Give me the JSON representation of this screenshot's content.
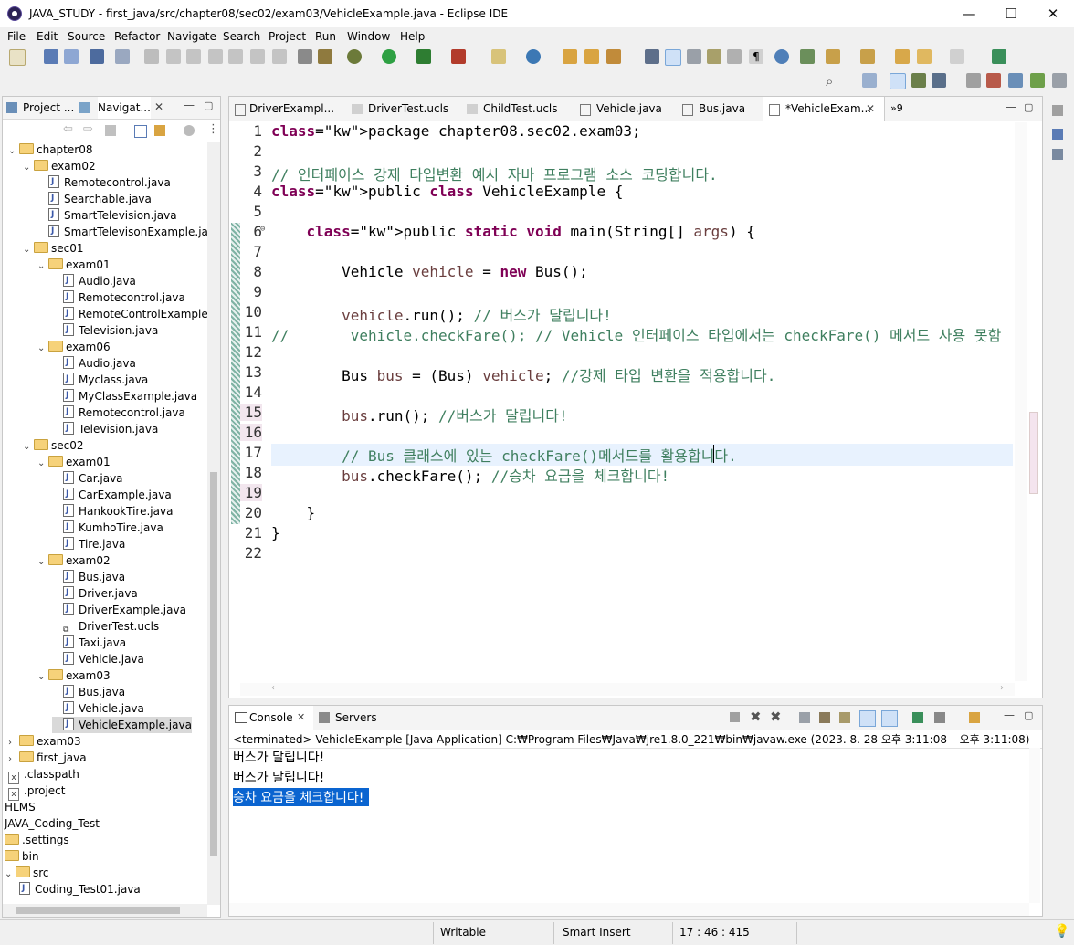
{
  "window": {
    "title": "JAVA_STUDY - first_java/src/chapter08/sec02/exam03/VehicleExample.java - Eclipse IDE",
    "minimize": "—",
    "maximize": "☐",
    "close": "✕"
  },
  "menu": [
    "File",
    "Edit",
    "Source",
    "Refactor",
    "Navigate",
    "Search",
    "Project",
    "Run",
    "Window",
    "Help"
  ],
  "left_tabs": [
    "Project ...",
    "Navigat..."
  ],
  "tree": [
    {
      "label": "chapter08",
      "indent": 0,
      "kind": "folder",
      "twist": "v"
    },
    {
      "label": "exam02",
      "indent": 1,
      "kind": "folder",
      "twist": "v"
    },
    {
      "label": "Remotecontrol.java",
      "indent": 2,
      "kind": "java"
    },
    {
      "label": "Searchable.java",
      "indent": 2,
      "kind": "java"
    },
    {
      "label": "SmartTelevision.java",
      "indent": 2,
      "kind": "java"
    },
    {
      "label": "SmartTelevisonExample.java",
      "indent": 2,
      "kind": "java"
    },
    {
      "label": "sec01",
      "indent": 1,
      "kind": "folder",
      "twist": "v"
    },
    {
      "label": "exam01",
      "indent": 2,
      "kind": "folder",
      "twist": "v"
    },
    {
      "label": "Audio.java",
      "indent": 3,
      "kind": "java"
    },
    {
      "label": "Remotecontrol.java",
      "indent": 3,
      "kind": "java"
    },
    {
      "label": "RemoteControlExample.ja",
      "indent": 3,
      "kind": "java"
    },
    {
      "label": "Television.java",
      "indent": 3,
      "kind": "java"
    },
    {
      "label": "exam06",
      "indent": 2,
      "kind": "folder",
      "twist": "v"
    },
    {
      "label": "Audio.java",
      "indent": 3,
      "kind": "java"
    },
    {
      "label": "Myclass.java",
      "indent": 3,
      "kind": "java"
    },
    {
      "label": "MyClassExample.java",
      "indent": 3,
      "kind": "java"
    },
    {
      "label": "Remotecontrol.java",
      "indent": 3,
      "kind": "java"
    },
    {
      "label": "Television.java",
      "indent": 3,
      "kind": "java"
    },
    {
      "label": "sec02",
      "indent": 1,
      "kind": "folder",
      "twist": "v"
    },
    {
      "label": "exam01",
      "indent": 2,
      "kind": "folder",
      "twist": "v"
    },
    {
      "label": "Car.java",
      "indent": 3,
      "kind": "java"
    },
    {
      "label": "CarExample.java",
      "indent": 3,
      "kind": "java"
    },
    {
      "label": "HankookTire.java",
      "indent": 3,
      "kind": "java"
    },
    {
      "label": "KumhoTire.java",
      "indent": 3,
      "kind": "java"
    },
    {
      "label": "Tire.java",
      "indent": 3,
      "kind": "java"
    },
    {
      "label": "exam02",
      "indent": 2,
      "kind": "folder",
      "twist": "v"
    },
    {
      "label": "Bus.java",
      "indent": 3,
      "kind": "java"
    },
    {
      "label": "Driver.java",
      "indent": 3,
      "kind": "java"
    },
    {
      "label": "DriverExample.java",
      "indent": 3,
      "kind": "java"
    },
    {
      "label": "DriverTest.ucls",
      "indent": 3,
      "kind": "ucls"
    },
    {
      "label": "Taxi.java",
      "indent": 3,
      "kind": "java"
    },
    {
      "label": "Vehicle.java",
      "indent": 3,
      "kind": "java"
    },
    {
      "label": "exam03",
      "indent": 2,
      "kind": "folder",
      "twist": "v"
    },
    {
      "label": "Bus.java",
      "indent": 3,
      "kind": "java"
    },
    {
      "label": "Vehicle.java",
      "indent": 3,
      "kind": "java"
    },
    {
      "label": "VehicleExample.java",
      "indent": 3,
      "kind": "java",
      "selected": true
    },
    {
      "label": "exam03",
      "indent": 0,
      "kind": "folder",
      "twist": ">"
    },
    {
      "label": "first_java",
      "indent": 0,
      "kind": "folder",
      "twist": ">"
    },
    {
      "label": ".classpath",
      "indent": -1,
      "kind": "x"
    },
    {
      "label": ".project",
      "indent": -1,
      "kind": "x"
    },
    {
      "label": "HLMS",
      "indent": -2,
      "kind": "none"
    },
    {
      "label": "JAVA_Coding_Test",
      "indent": -2,
      "kind": "none"
    },
    {
      "label": ".settings",
      "indent": -2,
      "kind": "folder"
    },
    {
      "label": "bin",
      "indent": -2,
      "kind": "folder"
    },
    {
      "label": "src",
      "indent": -2,
      "kind": "folder",
      "twist": "v"
    },
    {
      "label": "Coding_Test01.java",
      "indent": 0,
      "kind": "java"
    }
  ],
  "editor_tabs": [
    {
      "label": "DriverExampl..."
    },
    {
      "label": "DriverTest.ucls"
    },
    {
      "label": "ChildTest.ucls"
    },
    {
      "label": "Vehicle.java"
    },
    {
      "label": "Bus.java"
    },
    {
      "label": "*VehicleExam...",
      "active": true
    },
    {
      "label": "»9"
    }
  ],
  "code_lines": [
    "package chapter08.sec02.exam03;",
    "",
    "// 인터페이스 강제 타입변환 예시 자바 프로그램 소스 코딩합니다.",
    "public class VehicleExample {",
    "",
    "    public static void main(String[] args) {",
    "",
    "        Vehicle vehicle = new Bus();",
    "",
    "        vehicle.run(); // 버스가 달립니다!",
    "//       vehicle.checkFare(); // Vehicle 인터페이스 타입에서는 checkFare() 메서드 사용 못함",
    "",
    "        Bus bus = (Bus) vehicle; //강제 타입 변환을 적용합니다.",
    "",
    "        bus.run(); //버스가 달립니다!",
    "",
    "        // Bus 클래스에 있는 checkFare()메서드를 활용합니다.",
    "        bus.checkFare(); //승차 요금을 체크합니다!",
    "",
    "    }",
    "}",
    ""
  ],
  "console": {
    "tab_console": "Console",
    "tab_servers": "Servers",
    "header": "<terminated> VehicleExample [Java Application] C:₩Program Files₩Java₩jre1.8.0_221₩bin₩javaw.exe  (2023. 8. 28 오후 3:11:08 – 오후 3:11:08)",
    "lines": [
      "버스가 달립니다!",
      "버스가 달립니다!",
      "승차 요금을 체크합니다!"
    ]
  },
  "status": {
    "writable": "Writable",
    "insert": "Smart Insert",
    "position": "17 : 46 : 415"
  }
}
